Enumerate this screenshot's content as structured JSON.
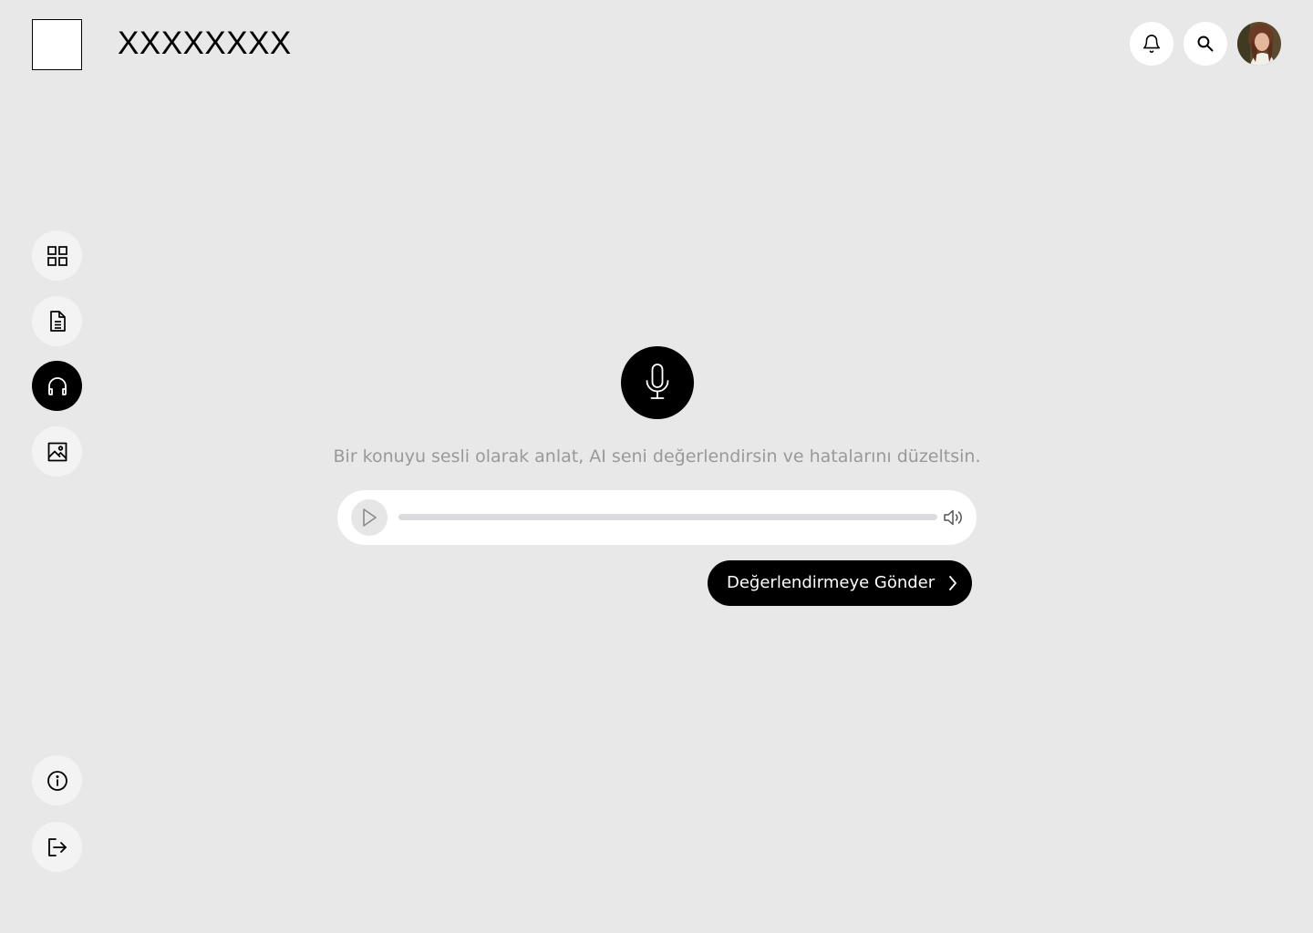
{
  "header": {
    "app_title": "XXXXXXXX",
    "actions": [
      {
        "icon": "bell-icon"
      },
      {
        "icon": "search-icon"
      }
    ],
    "avatar_icon": "user-avatar"
  },
  "sidebar": {
    "items": [
      {
        "icon": "grid-icon",
        "active": false
      },
      {
        "icon": "document-icon",
        "active": false
      },
      {
        "icon": "headphones-icon",
        "active": true
      },
      {
        "icon": "image-icon",
        "active": false
      }
    ],
    "bottom_items": [
      {
        "icon": "info-icon"
      },
      {
        "icon": "logout-icon"
      }
    ]
  },
  "main": {
    "mic_icon": "microphone-icon",
    "instruction": "Bir konuyu sesli olarak anlat, AI seni değerlendirsin ve hatalarını düzeltsin.",
    "player": {
      "play_icon": "play-icon",
      "progress": 0,
      "volume_icon": "volume-icon"
    },
    "submit_label": "Değerlendirmeye Gönder"
  },
  "colors": {
    "background": "#e8e8e8",
    "accent": "#000000",
    "muted_text": "#999999",
    "surface": "#ffffff"
  }
}
